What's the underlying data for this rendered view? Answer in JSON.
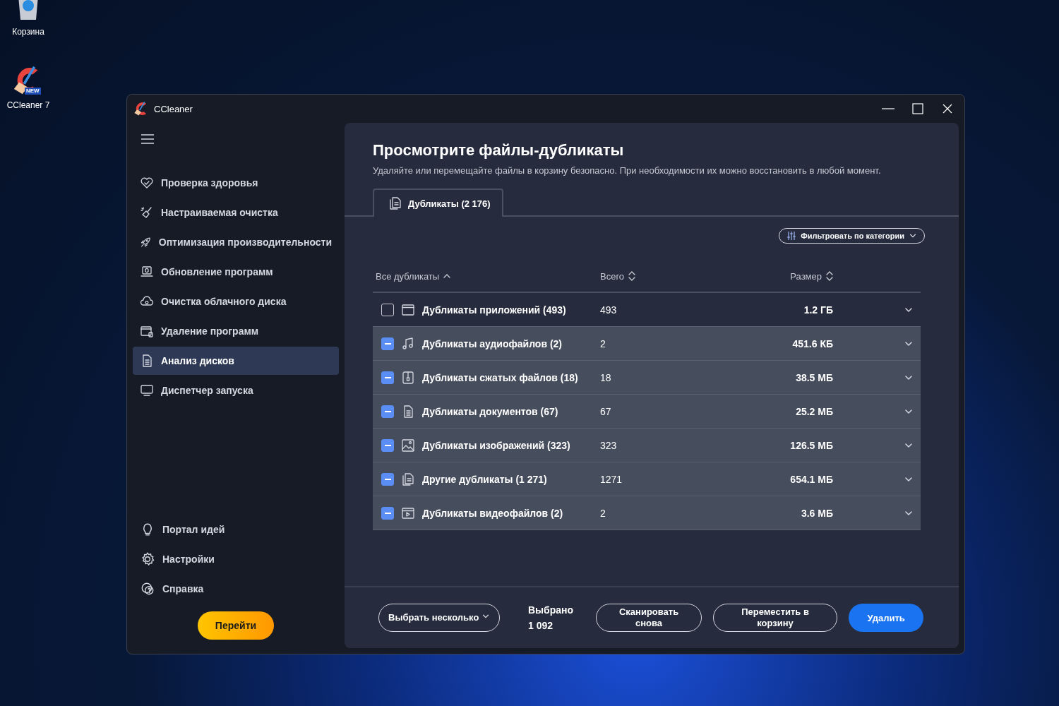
{
  "desktop": {
    "icons": [
      {
        "kind": "recycle",
        "label": "Корзина"
      },
      {
        "kind": "ccleaner",
        "label": "CCleaner 7",
        "badge": "NEW"
      }
    ]
  },
  "window": {
    "title": "CCleaner"
  },
  "sidebar": {
    "items": [
      {
        "kind": "heart",
        "label": "Проверка здоровья",
        "selected": false
      },
      {
        "kind": "broom",
        "label": "Настраиваемая очистка",
        "selected": false
      },
      {
        "kind": "rocket",
        "label": "Оптимизация производительности",
        "selected": false
      },
      {
        "kind": "update",
        "label": "Обновление программ",
        "selected": false
      },
      {
        "kind": "cloud",
        "label": "Очистка облачного диска",
        "selected": false
      },
      {
        "kind": "uninstall",
        "label": "Удаление программ",
        "selected": false
      },
      {
        "kind": "doc",
        "label": "Анализ дисков",
        "selected": true
      },
      {
        "kind": "monitor",
        "label": "Диспетчер запуска",
        "selected": false
      }
    ],
    "bottom_items": [
      {
        "kind": "bulb",
        "label": "Портал идей"
      },
      {
        "kind": "gear",
        "label": "Настройки"
      },
      {
        "kind": "help",
        "label": "Справка"
      }
    ],
    "cta_button": "Перейти"
  },
  "main": {
    "title": "Просмотрите файлы-дубликаты",
    "subtitle": "Удаляйте или перемещайте файлы в корзину безопасно. При необходимости их можно восстановить в любой момент.",
    "tabs": [
      {
        "label": "Дубликаты (2 176)",
        "selected": true
      }
    ],
    "filter_button": "Фильтровать по категории",
    "table": {
      "columns": [
        "Все дубликаты",
        "Всего",
        "Размер"
      ],
      "rows": [
        {
          "kind": "app",
          "indeterminate": false,
          "name": "Дубликаты приложений (493)",
          "total": "493",
          "size": "1.2 ГБ"
        },
        {
          "kind": "audio",
          "indeterminate": true,
          "name": "Дубликаты аудиофайлов (2)",
          "total": "2",
          "size": "451.6 КБ"
        },
        {
          "kind": "zip",
          "indeterminate": true,
          "name": "Дубликаты сжатых файлов (18)",
          "total": "18",
          "size": "38.5 МБ"
        },
        {
          "kind": "doc",
          "indeterminate": true,
          "name": "Дубликаты документов (67)",
          "total": "67",
          "size": "25.2 МБ"
        },
        {
          "kind": "image",
          "indeterminate": true,
          "name": "Дубликаты изображений (323)",
          "total": "323",
          "size": "126.5 МБ"
        },
        {
          "kind": "docs",
          "indeterminate": true,
          "name": "Другие дубликаты (1 271)",
          "total": "1271",
          "size": "654.1 МБ"
        },
        {
          "kind": "video",
          "indeterminate": true,
          "name": "Дубликаты видеофайлов (2)",
          "total": "2",
          "size": "3.6 МБ"
        }
      ]
    }
  },
  "footer": {
    "select_button": "Выбрать несколько",
    "selected_label": "Выбрано",
    "selected_count": "1 092",
    "rescan_button": "Сканировать снова",
    "move_button": "Переместить в корзину",
    "delete_button": "Удалить"
  }
}
